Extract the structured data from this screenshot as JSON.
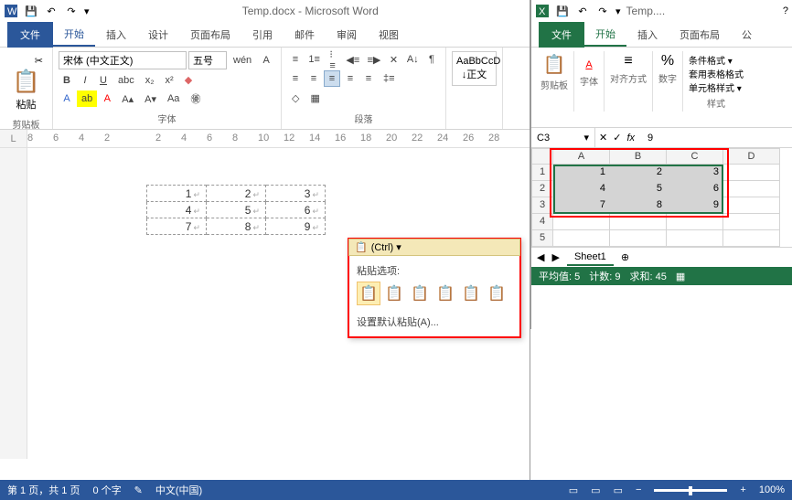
{
  "word": {
    "title": "Temp.docx - Microsoft Word",
    "tabs": {
      "file": "文件",
      "home": "开始",
      "insert": "插入",
      "design": "设计",
      "layout": "页面布局",
      "ref": "引用",
      "mail": "邮件",
      "review": "审阅",
      "view": "视图"
    },
    "font": {
      "name": "宋体 (中文正文)",
      "size": "五号"
    },
    "groups": {
      "clipboard": "剪贴板",
      "font": "字体",
      "paragraph": "段落"
    },
    "style_preview": "AaBbCcD",
    "style_name": "↓正文",
    "paste_label": "粘贴",
    "ruler": [
      "8",
      "6",
      "4",
      "2",
      "",
      "2",
      "4",
      "6",
      "8",
      "10",
      "12",
      "14",
      "16",
      "18",
      "20",
      "22",
      "24",
      "26",
      "28"
    ],
    "table": [
      [
        "1",
        "2",
        "3"
      ],
      [
        "4",
        "5",
        "6"
      ],
      [
        "7",
        "8",
        "9"
      ]
    ],
    "popup": {
      "ctrl": "(Ctrl) ▾",
      "label": "粘贴选项:",
      "default": "设置默认粘贴(A)..."
    },
    "status": {
      "page": "第 1 页，共 1 页",
      "words": "0 个字",
      "lang": "中文(中国)",
      "zoom": "100%"
    }
  },
  "excel": {
    "title": "Temp....",
    "tabs": {
      "file": "文件",
      "home": "开始",
      "insert": "插入",
      "layout": "页面布局",
      "formula": "公"
    },
    "groups": {
      "clipboard": "剪贴板",
      "font": "字体",
      "align": "对齐方式",
      "number": "数字",
      "styles": "样式"
    },
    "style_items": {
      "cond": "条件格式 ▾",
      "table": "套用表格格式",
      "cell": "单元格样式 ▾"
    },
    "namebox": "C3",
    "fx_value": "9",
    "cols": [
      "A",
      "B",
      "C",
      "D"
    ],
    "rows": [
      "1",
      "2",
      "3",
      "4",
      "5"
    ],
    "data": [
      [
        "1",
        "2",
        "3"
      ],
      [
        "4",
        "5",
        "6"
      ],
      [
        "7",
        "8",
        "9"
      ]
    ],
    "sheet": "Sheet1",
    "status": {
      "avg": "平均值: 5",
      "count": "计数: 9",
      "sum": "求和: 45"
    }
  },
  "chart_data": {
    "type": "table",
    "title": "Pasted Excel range",
    "columns": [
      "A",
      "B",
      "C"
    ],
    "rows": [
      [
        1,
        2,
        3
      ],
      [
        4,
        5,
        6
      ],
      [
        7,
        8,
        9
      ]
    ]
  }
}
